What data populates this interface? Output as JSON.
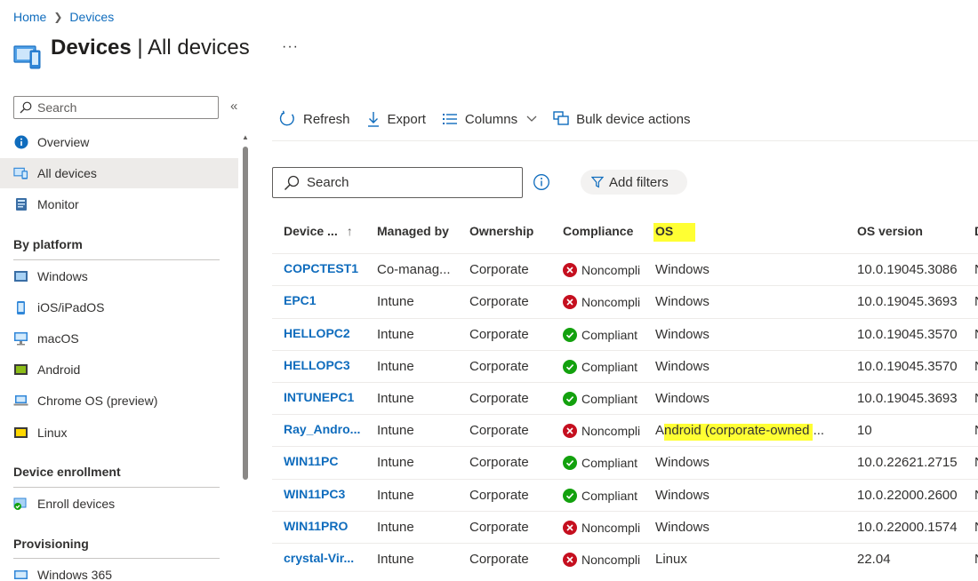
{
  "breadcrumb": {
    "home": "Home",
    "current": "Devices"
  },
  "page": {
    "title_main": "Devices",
    "title_sep": " | ",
    "title_sub": "All devices",
    "more": "···"
  },
  "nav": {
    "search_placeholder": "Search",
    "collapse": "«",
    "top_items": [
      {
        "label": "Overview",
        "icon": "info-circle-icon"
      },
      {
        "label": "All devices",
        "icon": "devices-icon",
        "active": true
      },
      {
        "label": "Monitor",
        "icon": "monitor-book-icon"
      }
    ],
    "sections": [
      {
        "title": "By platform",
        "items": [
          {
            "label": "Windows",
            "icon": "windows-icon"
          },
          {
            "label": "iOS/iPadOS",
            "icon": "phone-icon"
          },
          {
            "label": "macOS",
            "icon": "desktop-icon"
          },
          {
            "label": "Android",
            "icon": "android-icon"
          },
          {
            "label": "Chrome OS (preview)",
            "icon": "laptop-icon"
          },
          {
            "label": "Linux",
            "icon": "linux-icon"
          }
        ]
      },
      {
        "title": "Device enrollment",
        "items": [
          {
            "label": "Enroll devices",
            "icon": "enroll-icon"
          }
        ]
      },
      {
        "title": "Provisioning",
        "items": [
          {
            "label": "Windows 365",
            "icon": "cloud-pc-icon"
          }
        ]
      }
    ]
  },
  "toolbar": {
    "refresh": "Refresh",
    "export": "Export",
    "columns": "Columns",
    "bulk": "Bulk device actions"
  },
  "filters": {
    "search_placeholder": "Search",
    "add_filters": "Add filters"
  },
  "table": {
    "columns": [
      "Device ...",
      "Managed by",
      "Ownership",
      "Compliance",
      "OS",
      "OS version",
      "D"
    ],
    "sort_indicator": "↑",
    "rows": [
      {
        "device": "COPCTEST1",
        "managed": "Co-manag...",
        "ownership": "Corporate",
        "compliance": "Noncompli",
        "status": "non",
        "os": "Windows",
        "version": "10.0.19045.3086",
        "trail": "N"
      },
      {
        "device": "EPC1",
        "managed": "Intune",
        "ownership": "Corporate",
        "compliance": "Noncompli",
        "status": "non",
        "os": "Windows",
        "version": "10.0.19045.3693",
        "trail": "N"
      },
      {
        "device": "HELLOPC2",
        "managed": "Intune",
        "ownership": "Corporate",
        "compliance": "Compliant",
        "status": "ok",
        "os": "Windows",
        "version": "10.0.19045.3570",
        "trail": "N"
      },
      {
        "device": "HELLOPC3",
        "managed": "Intune",
        "ownership": "Corporate",
        "compliance": "Compliant",
        "status": "ok",
        "os": "Windows",
        "version": "10.0.19045.3570",
        "trail": "N"
      },
      {
        "device": "INTUNEPC1",
        "managed": "Intune",
        "ownership": "Corporate",
        "compliance": "Compliant",
        "status": "ok",
        "os": "Windows",
        "version": "10.0.19045.3693",
        "trail": "N"
      },
      {
        "device": "Ray_Andro...",
        "managed": "Intune",
        "ownership": "Corporate",
        "compliance": "Noncompli",
        "status": "non",
        "os": "Android (corporate-owned ...",
        "version": "10",
        "trail": "N"
      },
      {
        "device": "WIN11PC",
        "managed": "Intune",
        "ownership": "Corporate",
        "compliance": "Compliant",
        "status": "ok",
        "os": "Windows",
        "version": "10.0.22621.2715",
        "trail": "N"
      },
      {
        "device": "WIN11PC3",
        "managed": "Intune",
        "ownership": "Corporate",
        "compliance": "Compliant",
        "status": "ok",
        "os": "Windows",
        "version": "10.0.22000.2600",
        "trail": "N"
      },
      {
        "device": "WIN11PRO",
        "managed": "Intune",
        "ownership": "Corporate",
        "compliance": "Noncompli",
        "status": "non",
        "os": "Windows",
        "version": "10.0.22000.1574",
        "trail": "N"
      },
      {
        "device": "crystal-Vir...",
        "managed": "Intune",
        "ownership": "Corporate",
        "compliance": "Noncompli",
        "status": "non",
        "os": "Linux",
        "version": "22.04",
        "trail": "N"
      }
    ]
  },
  "colors": {
    "link": "#0f6cbd",
    "compliant": "#13a10e",
    "noncompliant": "#c50f1f",
    "highlight": "#ffff33"
  }
}
